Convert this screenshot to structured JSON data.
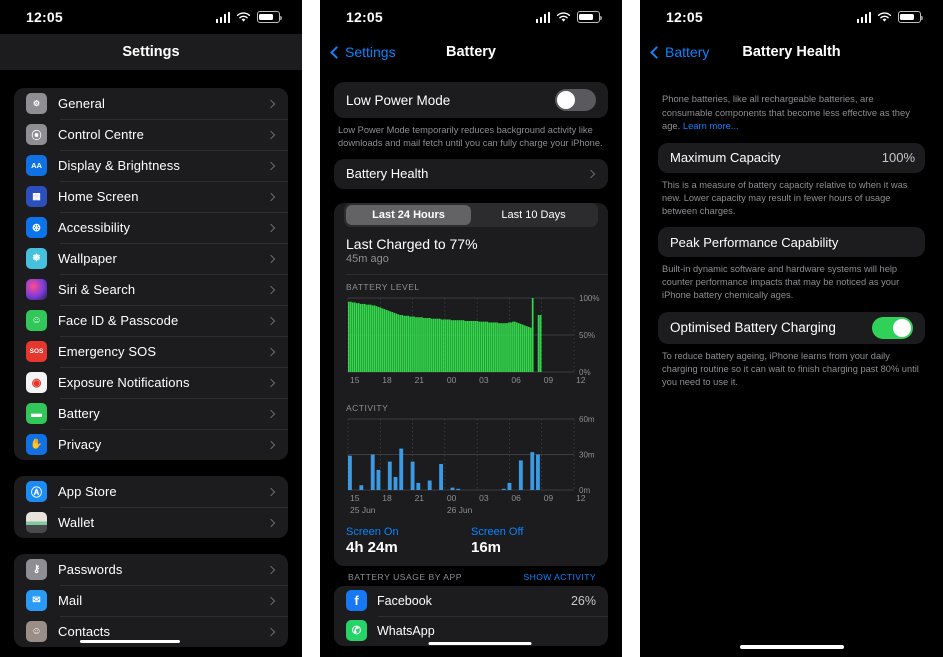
{
  "status_bar": {
    "time": "12:05",
    "signal_icon": "cellular-signal-icon",
    "wifi_icon": "wifi-icon",
    "battery_icon": "battery-icon"
  },
  "panel_settings": {
    "title": "Settings",
    "groups": [
      {
        "items": [
          {
            "label": "General",
            "icon": "gear-icon",
            "color": "#8e8e93",
            "glyph": "⚙"
          },
          {
            "label": "Control Centre",
            "icon": "control-centre-icon",
            "color": "#8e8e93",
            "glyph": "☷"
          },
          {
            "label": "Display & Brightness",
            "icon": "display-brightness-icon",
            "color": "#1071e5",
            "glyph": "AA"
          },
          {
            "label": "Home Screen",
            "icon": "home-screen-icon",
            "color": "#2c4fbe",
            "glyph": "☷"
          },
          {
            "label": "Accessibility",
            "icon": "accessibility-icon",
            "color": "#0a74e8",
            "glyph": "ⓝ"
          },
          {
            "label": "Wallpaper",
            "icon": "wallpaper-icon",
            "color": "#45c1dd",
            "glyph": "❀"
          },
          {
            "label": "Siri & Search",
            "icon": "siri-icon",
            "color": "#2b2b3a",
            "glyph": ""
          },
          {
            "label": "Face ID & Passcode",
            "icon": "face-id-icon",
            "color": "#32c759",
            "glyph": "☺"
          },
          {
            "label": "Emergency SOS",
            "icon": "emergency-sos-icon",
            "color": "#e5372e",
            "glyph": "SOS"
          },
          {
            "label": "Exposure Notifications",
            "icon": "exposure-notifications-icon",
            "color": "#f5f5f5",
            "glyph": "◉"
          },
          {
            "label": "Battery",
            "icon": "battery-icon",
            "color": "#32c759",
            "glyph": "▭"
          },
          {
            "label": "Privacy",
            "icon": "privacy-icon",
            "color": "#1071e5",
            "glyph": "✋"
          }
        ]
      },
      {
        "items": [
          {
            "label": "App Store",
            "icon": "app-store-icon",
            "color": "#1b8cf3",
            "glyph": "A"
          },
          {
            "label": "Wallet",
            "icon": "wallet-icon",
            "color": "#3a3a3c",
            "glyph": "▮"
          }
        ]
      },
      {
        "items": [
          {
            "label": "Passwords",
            "icon": "passwords-icon",
            "color": "#8e8e93",
            "glyph": "⚷"
          },
          {
            "label": "Mail",
            "icon": "mail-icon",
            "color": "#2a9bf5",
            "glyph": "✉"
          },
          {
            "label": "Contacts",
            "icon": "contacts-icon",
            "color": "#9b8e86",
            "glyph": "☺"
          }
        ]
      }
    ]
  },
  "panel_battery": {
    "back_label": "Settings",
    "title": "Battery",
    "low_power_mode": {
      "label": "Low Power Mode",
      "enabled": false
    },
    "low_power_mode_footnote": "Low Power Mode temporarily reduces background activity like downloads and mail fetch until you can fully charge your iPhone.",
    "battery_health_row": "Battery Health",
    "segments": [
      "Last 24 Hours",
      "Last 10 Days"
    ],
    "selected_segment": "Last 24 Hours",
    "last_charged_title": "Last Charged to 77%",
    "last_charged_sub": "45m ago",
    "screen_on": {
      "label": "Screen On",
      "value": "4h 24m"
    },
    "screen_off": {
      "label": "Screen Off",
      "value": "16m"
    },
    "usage_header": "BATTERY USAGE BY APP",
    "show_activity": "SHOW ACTIVITY",
    "apps": [
      {
        "name": "Facebook",
        "percent": "26%",
        "color": "#1877f2",
        "glyph": "f"
      },
      {
        "name": "WhatsApp",
        "percent": "",
        "color": "#25d366",
        "glyph": "✆"
      }
    ]
  },
  "panel_battery_health": {
    "back_label": "Battery",
    "title": "Battery Health",
    "intro": "Phone batteries, like all rechargeable batteries, are consumable components that become less effective as they age.",
    "intro_link": "Learn more...",
    "maximum_capacity": {
      "label": "Maximum Capacity",
      "value": "100%"
    },
    "maximum_capacity_footnote": "This is a measure of battery capacity relative to when it was new. Lower capacity may result in fewer hours of usage between charges.",
    "peak_performance": {
      "label": "Peak Performance Capability"
    },
    "peak_performance_footnote": "Built-in dynamic software and hardware systems will help counter performance impacts that may be noticed as your iPhone battery chemically ages.",
    "optimised_charging": {
      "label": "Optimised Battery Charging",
      "enabled": true
    },
    "optimised_charging_footnote": "To reduce battery ageing, iPhone learns from your daily charging routine so it can wait to finish charging past 80% until you need to use it."
  },
  "chart_data": [
    {
      "type": "area",
      "title": "BATTERY LEVEL",
      "xlabel": "",
      "ylabel": "",
      "ylim": [
        0,
        100
      ],
      "ytick_labels": [
        "100%",
        "50%",
        "0%"
      ],
      "xtick_labels": [
        "15",
        "18",
        "21",
        "00",
        "03",
        "06",
        "09",
        "12"
      ],
      "color": "#32d74b",
      "grid": true,
      "values": [
        95,
        95,
        94,
        94,
        93,
        93,
        92,
        92,
        92,
        91,
        91,
        91,
        90,
        90,
        89,
        88,
        87,
        86,
        85,
        84,
        83,
        82,
        81,
        80,
        79,
        78,
        77,
        77,
        76,
        76,
        76,
        75,
        75,
        75,
        74,
        74,
        74,
        74,
        73,
        73,
        73,
        73,
        72,
        72,
        72,
        72,
        72,
        71,
        71,
        71,
        71,
        71,
        70,
        70,
        70,
        70,
        70,
        70,
        70,
        69,
        69,
        69,
        69,
        69,
        69,
        69,
        68,
        68,
        68,
        68,
        68,
        67,
        67,
        67,
        67,
        67,
        66,
        66,
        66,
        66,
        66,
        67,
        67,
        68,
        68,
        67,
        66,
        65,
        64,
        63,
        62,
        61,
        60,
        100,
        0,
        0,
        77,
        77
      ]
    },
    {
      "type": "bar",
      "title": "ACTIVITY",
      "xlabel": "",
      "ylabel": "",
      "ylim": [
        0,
        60
      ],
      "ytick_labels": [
        "60m",
        "30m",
        "0m"
      ],
      "xtick_labels": [
        "15",
        "18",
        "21",
        "00",
        "03",
        "06",
        "09",
        "12"
      ],
      "date_labels": [
        "25 Jun",
        "26 Jun"
      ],
      "color": "#3b9ae1",
      "grid": true,
      "values": [
        29,
        0,
        4,
        0,
        30,
        17,
        0,
        24,
        11,
        35,
        0,
        24,
        6,
        0,
        8,
        0,
        22,
        0,
        2,
        1,
        0,
        0,
        0,
        0,
        0,
        0,
        0,
        1,
        6,
        0,
        25,
        0,
        32,
        30
      ]
    }
  ]
}
